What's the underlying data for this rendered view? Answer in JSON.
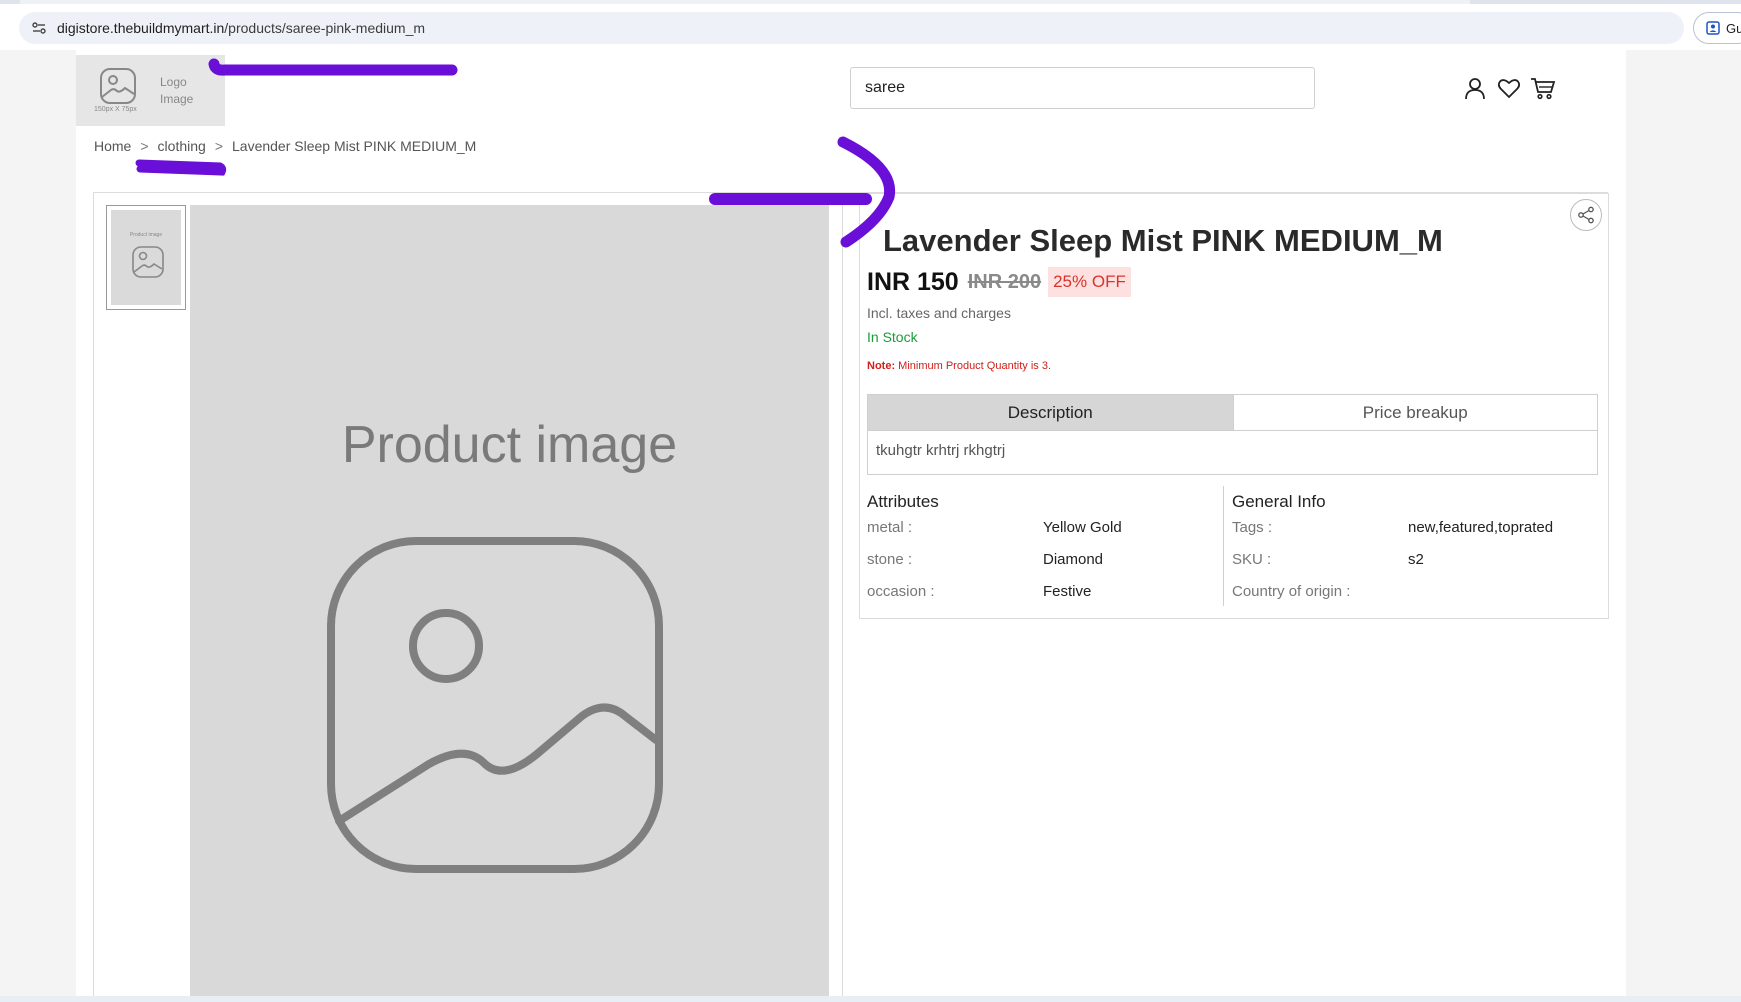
{
  "browser": {
    "url_host": "digistore.thebuildmymart.in",
    "url_path": "/products/saree-pink-medium_m",
    "profile_label": "Gu"
  },
  "header": {
    "logo_text": "Logo Image",
    "logo_size_note": "150px X 75px",
    "search_value": "saree",
    "icons": [
      "user-icon",
      "heart-icon",
      "cart-icon"
    ]
  },
  "breadcrumb": {
    "home": "Home",
    "category": "clothing",
    "current": "Lavender Sleep Mist PINK MEDIUM_M",
    "separator": ">"
  },
  "gallery": {
    "thumb_caption": "Product image",
    "main_caption": "Product image"
  },
  "product": {
    "title": "Lavender Sleep Mist PINK MEDIUM_M",
    "price": "INR 150",
    "old_price": "INR 200",
    "discount": "25% OFF",
    "tax_note": "Incl. taxes and charges",
    "stock": "In Stock",
    "note_label": "Note:",
    "note_text": " Minimum Product Quantity is 3."
  },
  "tabs": {
    "description_label": "Description",
    "price_breakup_label": "Price breakup",
    "description_text": "tkuhgtr krhtrj rkhgtrj"
  },
  "attributes": {
    "heading": "Attributes",
    "rows": [
      {
        "key": "metal :",
        "value": "Yellow Gold"
      },
      {
        "key": "stone :",
        "value": "Diamond"
      },
      {
        "key": "occasion :",
        "value": "Festive"
      }
    ]
  },
  "general_info": {
    "heading": "General Info",
    "rows": [
      {
        "key": "Tags :",
        "value": "new,featured,toprated"
      },
      {
        "key": "SKU :",
        "value": "s2"
      },
      {
        "key": "Country of origin :",
        "value": ""
      }
    ]
  },
  "colors": {
    "annotation": "#6a0fd8",
    "in_stock": "#1a9e3a",
    "discount_text": "#d9342b",
    "discount_bg": "#fde0e0",
    "note": "#d0201a"
  }
}
